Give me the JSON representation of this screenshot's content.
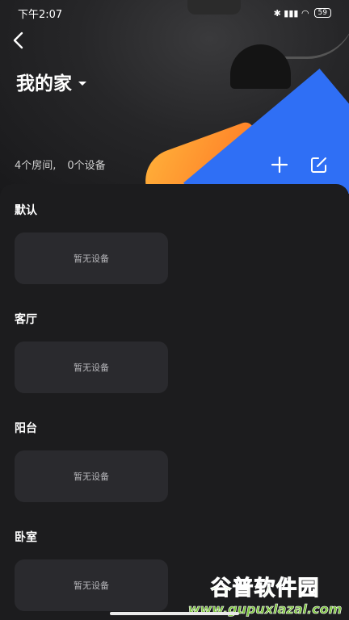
{
  "status_bar": {
    "time": "下午2:07",
    "icons": "✱ ▮▮▮ ◠",
    "battery": "59"
  },
  "header": {
    "home_name": "我的家"
  },
  "summary": {
    "rooms": "4个房间,",
    "devices": "0个设备"
  },
  "rooms": [
    {
      "name": "默认",
      "empty_text": "暂无设备"
    },
    {
      "name": "客厅",
      "empty_text": "暂无设备"
    },
    {
      "name": "阳台",
      "empty_text": "暂无设备"
    },
    {
      "name": "卧室",
      "empty_text": "暂无设备"
    }
  ],
  "watermark": {
    "line1": "谷普软件园",
    "line2": "www.gupuxlazal.com"
  }
}
